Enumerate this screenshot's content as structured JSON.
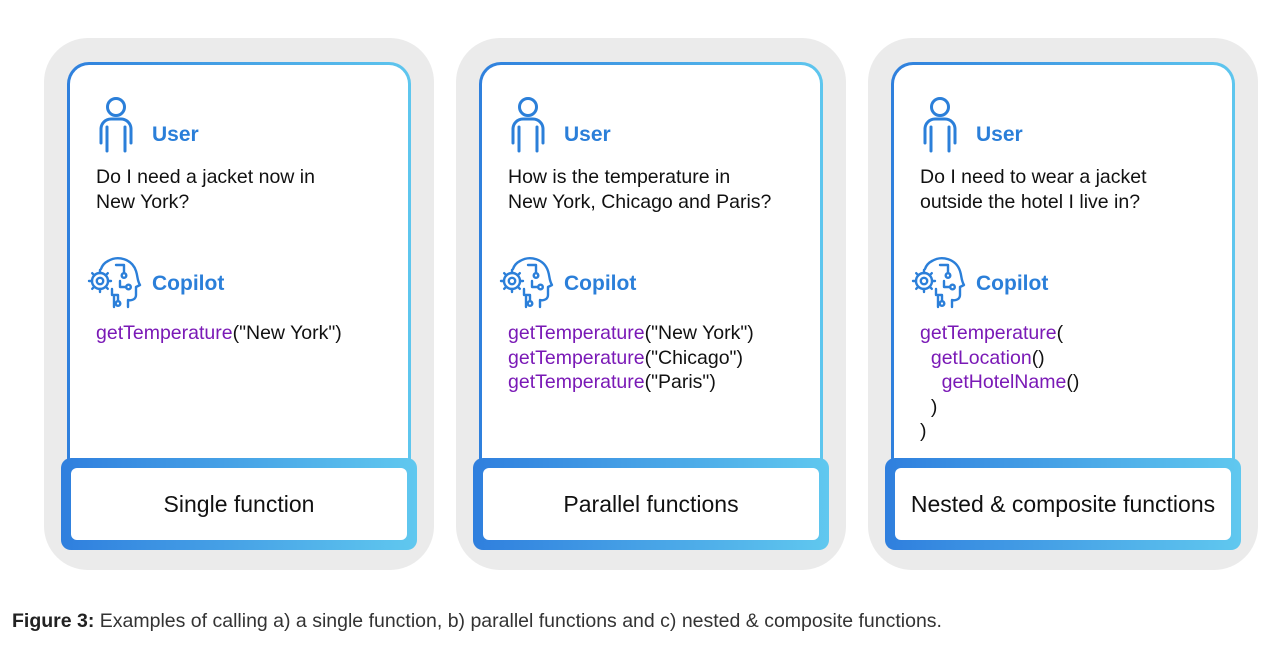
{
  "colors": {
    "accent_blue": "#2b7fd9",
    "function_purple": "#7a19b6",
    "panel_gray": "#ebebeb",
    "gradient_start": "#2f80dd",
    "gradient_end": "#5ec6ee"
  },
  "icons": {
    "user": "user-icon",
    "copilot": "ai-head-gear-icon"
  },
  "panels": [
    {
      "user_label": "User",
      "question_lines": [
        "Do I need a jacket now in",
        "New York?"
      ],
      "copilot_label": "Copilot",
      "code_lines": [
        {
          "indent": "",
          "fn": "getTemperature",
          "rest": "(\"New York\")"
        }
      ],
      "footer": "Single function"
    },
    {
      "user_label": "User",
      "question_lines": [
        "How is the temperature in",
        "New York, Chicago and Paris?"
      ],
      "copilot_label": "Copilot",
      "code_lines": [
        {
          "indent": "",
          "fn": "getTemperature",
          "rest": "(\"New York\")"
        },
        {
          "indent": "",
          "fn": "getTemperature",
          "rest": "(\"Chicago\")"
        },
        {
          "indent": "",
          "fn": "getTemperature",
          "rest": "(\"Paris\")"
        }
      ],
      "footer": "Parallel functions"
    },
    {
      "user_label": "User",
      "question_lines": [
        "Do I need to wear a jacket",
        "outside the hotel I live in?"
      ],
      "copilot_label": "Copilot",
      "code_lines": [
        {
          "indent": "",
          "fn": "getTemperature",
          "rest": "("
        },
        {
          "indent": "  ",
          "fn": "getLocation",
          "rest": "()"
        },
        {
          "indent": "    ",
          "fn": "getHotelName",
          "rest": "()"
        },
        {
          "indent": "  ",
          "fn": "",
          "rest": ")"
        },
        {
          "indent": "",
          "fn": "",
          "rest": ")"
        }
      ],
      "footer": "Nested & composite functions"
    }
  ],
  "caption": {
    "label": "Figure 3:",
    "text": " Examples of calling a) a single function, b) parallel functions and c) nested & composite functions."
  }
}
